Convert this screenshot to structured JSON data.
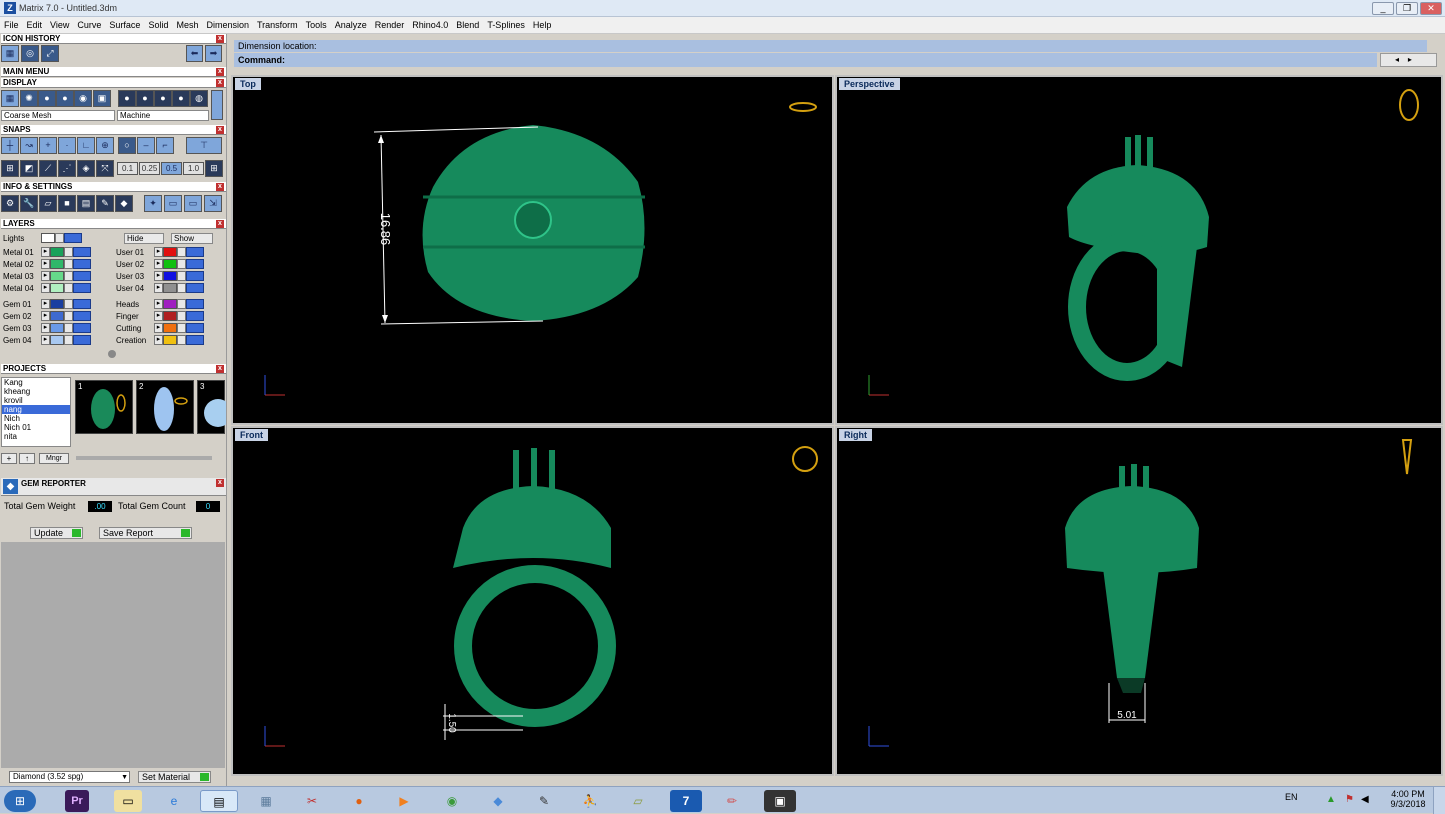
{
  "window": {
    "title": "Matrix 7.0 - Untitled.3dm",
    "controls": [
      "_",
      "❐",
      "✕"
    ]
  },
  "menu": [
    "File",
    "Edit",
    "View",
    "Curve",
    "Surface",
    "Solid",
    "Mesh",
    "Dimension",
    "Transform",
    "Tools",
    "Analyze",
    "Render",
    "Rhino4.0",
    "Blend",
    "T-Splines",
    "Help"
  ],
  "left": {
    "icon_history": "ICON HISTORY",
    "main_menu": "MAIN MENU",
    "display": "DISPLAY",
    "display_mesh": "Coarse Mesh",
    "display_render": "Machine",
    "snaps": "SNAPS",
    "snap_values": [
      "0.1",
      "0.25",
      "0.5",
      "1.0"
    ],
    "info_settings": "INFO & SETTINGS",
    "layers": "LAYERS",
    "lights": "Lights",
    "hide": "Hide",
    "show": "Show",
    "layer_left": [
      {
        "name": "Metal 01",
        "color": "#19a15a"
      },
      {
        "name": "Metal 02",
        "color": "#2fb86a"
      },
      {
        "name": "Metal 03",
        "color": "#66d98a"
      },
      {
        "name": "Metal 04",
        "color": "#b0f0c0"
      },
      {
        "name": "Gem 01",
        "color": "#1a3fa0"
      },
      {
        "name": "Gem 02",
        "color": "#3e6ad0"
      },
      {
        "name": "Gem 03",
        "color": "#6a9ae8"
      },
      {
        "name": "Gem 04",
        "color": "#a8c8f0"
      }
    ],
    "layer_right": [
      {
        "name": "User 01",
        "color": "#e01010"
      },
      {
        "name": "User 02",
        "color": "#10c010"
      },
      {
        "name": "User 03",
        "color": "#1010e0"
      },
      {
        "name": "User 04",
        "color": "#909090"
      },
      {
        "name": "Heads",
        "color": "#a020c0"
      },
      {
        "name": "Finger",
        "color": "#b02020"
      },
      {
        "name": "Cutting",
        "color": "#f07010"
      },
      {
        "name": "Creation",
        "color": "#f0c010"
      }
    ],
    "projects": "PROJECTS",
    "project_list": [
      "Kang",
      "kheang",
      "krovil",
      "nang",
      "Nich",
      "Nich 01",
      "nita"
    ],
    "project_selected": "nang",
    "thumb_nums": [
      "1",
      "2",
      "3"
    ],
    "mngr": "Mngr",
    "gem_reporter": "GEM REPORTER",
    "total_weight_label": "Total Gem Weight",
    "total_weight": ".00",
    "total_count_label": "Total Gem Count",
    "total_count": "0",
    "update": "Update",
    "save_report": "Save Report",
    "material": "Diamond",
    "material_spg": "(3.52 spg)",
    "set_material": "Set Material"
  },
  "command": {
    "line1": "Dimension location:",
    "line2": "Command:"
  },
  "viewports": {
    "top": {
      "label": "Top",
      "dim": "16.86"
    },
    "perspective": {
      "label": "Perspective"
    },
    "front": {
      "label": "Front",
      "dim": "1.50"
    },
    "right": {
      "label": "Right",
      "dim": "5.01"
    }
  },
  "taskbar": {
    "lang": "EN",
    "time": "4:00 PM",
    "date": "9/3/2018"
  }
}
